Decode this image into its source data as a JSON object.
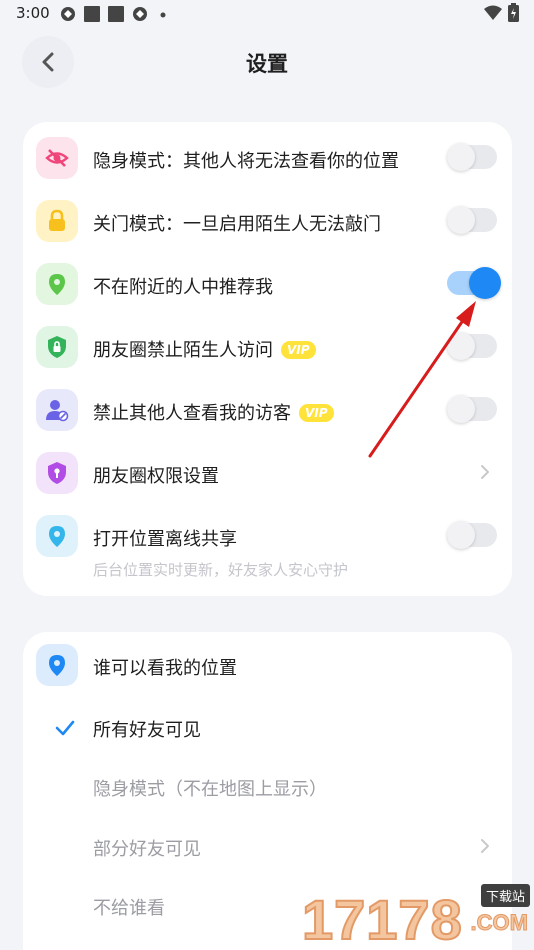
{
  "status_bar": {
    "time": "3:00"
  },
  "header": {
    "title": "设置"
  },
  "privacy": {
    "items": [
      {
        "label": "隐身模式：其他人将无法查看你的位置",
        "toggle": "off"
      },
      {
        "label": "关门模式：一旦启用陌生人无法敲门",
        "toggle": "off"
      },
      {
        "label": "不在附近的人中推荐我",
        "toggle": "on"
      },
      {
        "label": "朋友圈禁止陌生人访问",
        "badge": "VIP",
        "toggle": "off"
      },
      {
        "label": "禁止其他人查看我的访客",
        "badge": "VIP",
        "toggle": "off"
      },
      {
        "label": "朋友圈权限设置"
      },
      {
        "label": "打开位置离线共享",
        "sublabel": "后台位置实时更新，好友家人安心守护",
        "toggle": "off"
      }
    ]
  },
  "visibility": {
    "title": "谁可以看我的位置",
    "options": [
      "所有好友可见",
      "隐身模式（不在地图上显示）",
      "部分好友可见",
      "不给谁看"
    ],
    "selected_index": 0
  },
  "watermark": {
    "number": "17178",
    "tag": "下载站",
    "suffix": ".COM"
  },
  "colors": {
    "accent": "#1e88f5",
    "toggle_on_track": "#a8d2fb",
    "vip": "#ffe23a",
    "annotation_arrow": "#d81b1b"
  }
}
